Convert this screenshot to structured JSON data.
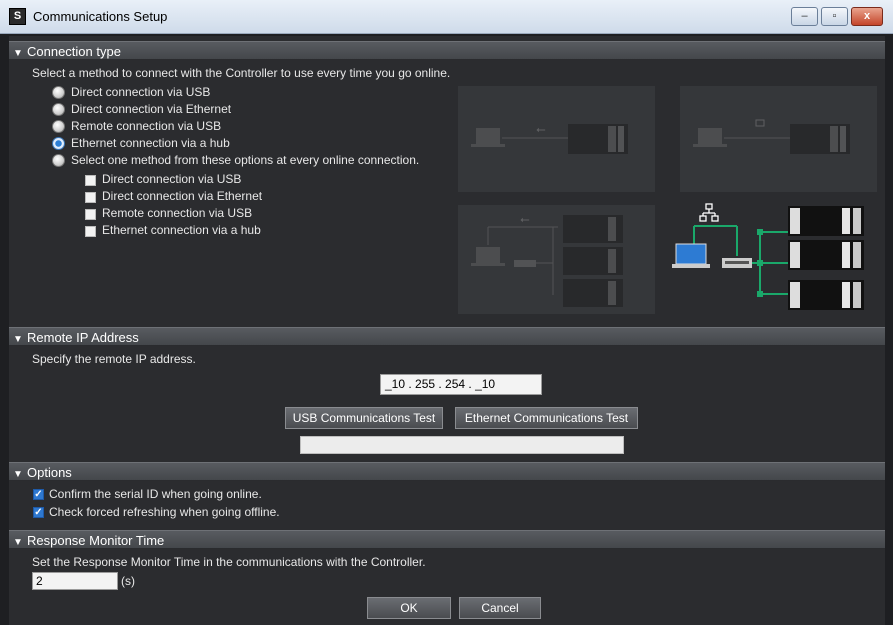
{
  "window": {
    "title": "Communications Setup",
    "app_icon": "S",
    "minimize_glyph": "–",
    "maximize_glyph": "▫",
    "close_glyph": "x"
  },
  "connection_type": {
    "header": "Connection type",
    "instruction": "Select a method to connect with the Controller to use every time you go online.",
    "options": [
      {
        "label": "Direct connection via USB",
        "selected": false
      },
      {
        "label": "Direct connection via Ethernet",
        "selected": false
      },
      {
        "label": "Remote connection via USB",
        "selected": false
      },
      {
        "label": "Ethernet connection via a hub",
        "selected": true
      },
      {
        "label": "Select one method from these options at every online connection.",
        "selected": false
      }
    ],
    "sub_options": [
      {
        "label": "Direct connection via USB",
        "checked": false
      },
      {
        "label": "Direct connection via Ethernet",
        "checked": false
      },
      {
        "label": "Remote connection via USB",
        "checked": false
      },
      {
        "label": "Ethernet connection via a hub",
        "checked": false
      }
    ],
    "diagram_icons": [
      "usb-icon",
      "network-icon",
      "laptop-icon",
      "hub-icon",
      "plc-icon"
    ],
    "highlight_color": "#1aa86a"
  },
  "remote_ip": {
    "header": "Remote IP Address",
    "instruction": "Specify the remote IP address.",
    "ip_value": "_10 . 255 . 254 . _10",
    "usb_test_label": "USB Communications Test",
    "ethernet_test_label": "Ethernet Communications Test",
    "result_text": ""
  },
  "options": {
    "header": "Options",
    "items": [
      {
        "label": "Confirm the serial ID when going online.",
        "checked": true
      },
      {
        "label": "Check forced refreshing when going offline.",
        "checked": true
      }
    ]
  },
  "response_monitor": {
    "header": "Response Monitor Time",
    "instruction": "Set the Response Monitor Time in the communications with the Controller.",
    "value": "2",
    "unit": "(s)"
  },
  "footer": {
    "ok_label": "OK",
    "cancel_label": "Cancel"
  }
}
